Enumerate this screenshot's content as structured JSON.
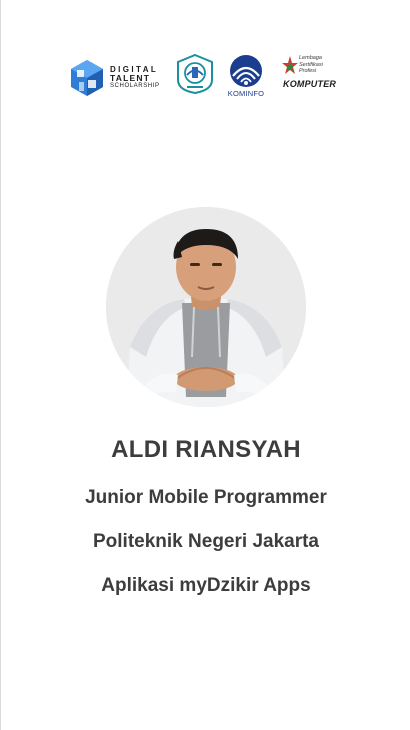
{
  "logos": {
    "dts": {
      "line1": "DIGITAL",
      "line2": "TALENT",
      "line3": "SCHOLARSHIP",
      "icon": "dts-cube-icon",
      "color": "#2e7dd6"
    },
    "pnj": {
      "icon": "polytechnic-badge-icon",
      "color": "#1a8fa0"
    },
    "kominfo": {
      "label": "KOMINFO",
      "icon": "kominfo-emblem-icon",
      "color": "#1b3d8f"
    },
    "lsp": {
      "line1": "Lembaga",
      "line2": "Sertifikasi",
      "line3": "Profesi",
      "brand": "KOMPUTER",
      "icon": "lsp-star-icon",
      "color": "#d43a2f"
    }
  },
  "profile": {
    "photo": "profile-photo",
    "name": "ALDI RIANSYAH",
    "job_title": "Junior Mobile Programmer",
    "institution": "Politeknik Negeri Jakarta",
    "app_name": "Aplikasi myDzikir Apps"
  },
  "colors": {
    "text": "#3d3d3d",
    "background": "#ffffff"
  }
}
